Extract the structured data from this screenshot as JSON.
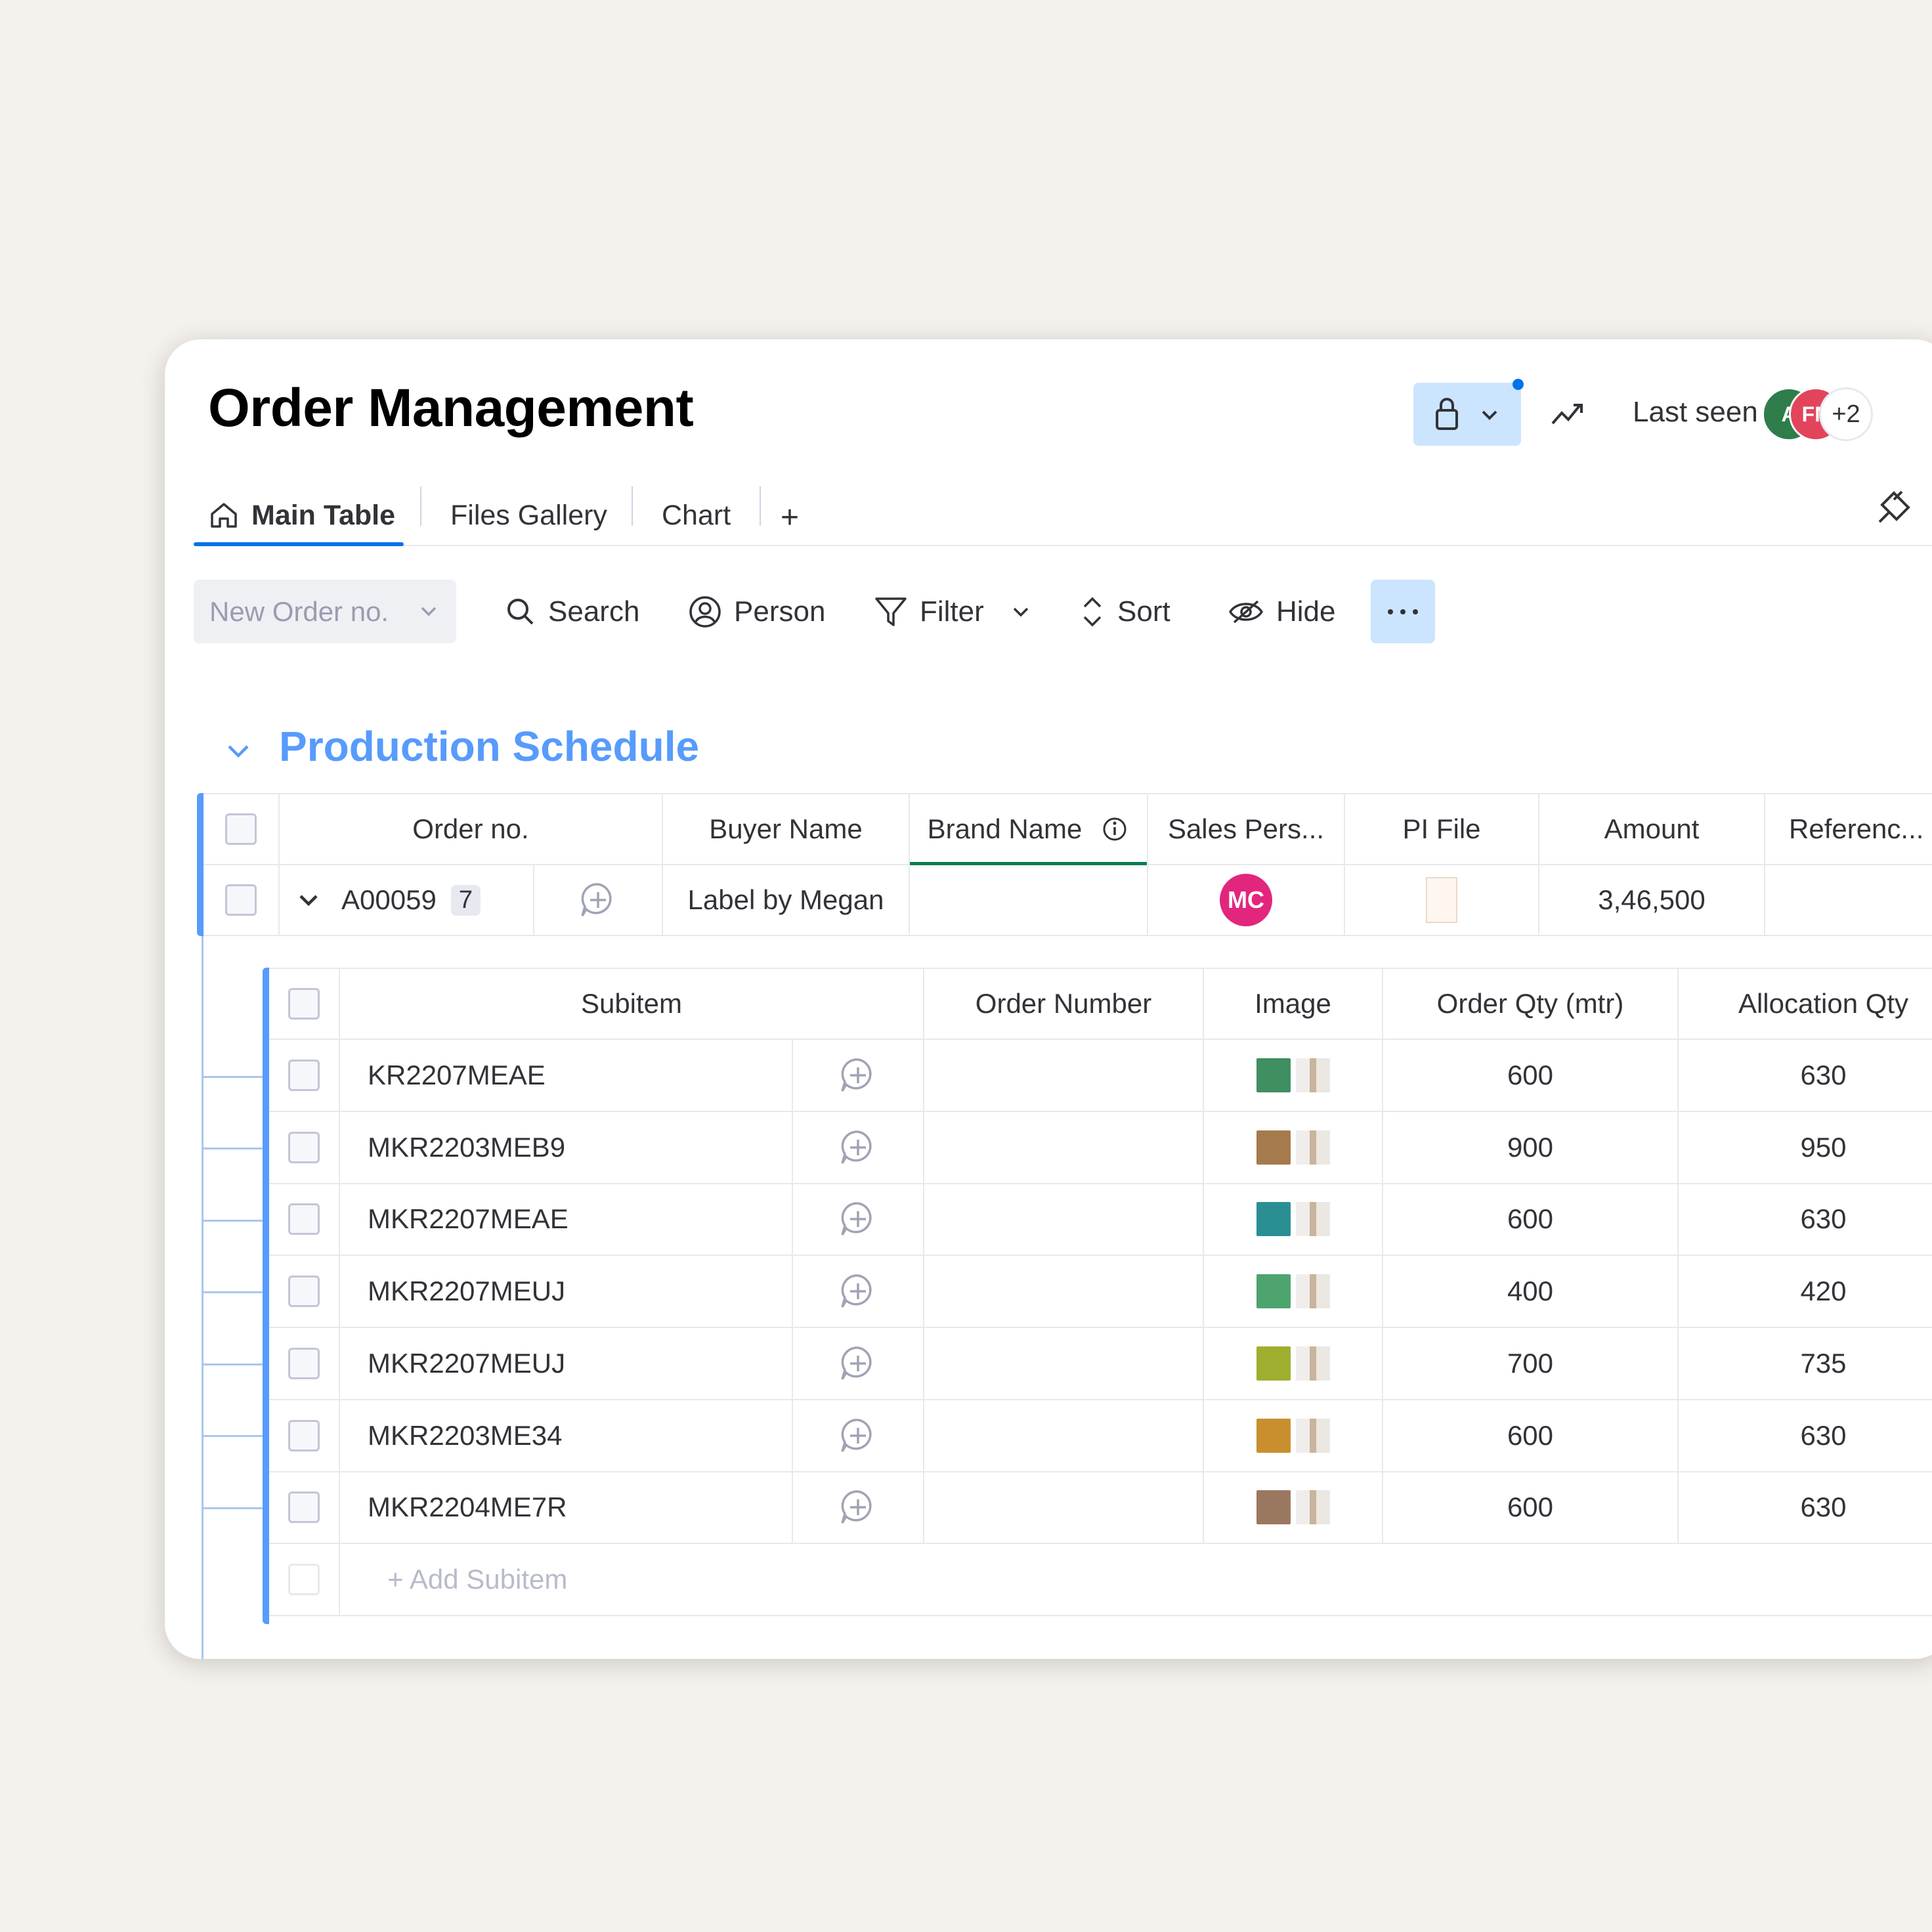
{
  "header": {
    "title": "Order Management",
    "last_seen_label": "Last seen",
    "avatars": [
      {
        "initials": "A",
        "color": "#2e7d4a"
      },
      {
        "initials": "FN",
        "color": "#e2445c"
      },
      {
        "initials": "+2",
        "color": "#ffffff"
      }
    ]
  },
  "tabs": [
    {
      "label": "Main Table",
      "active": true,
      "icon": "home-icon"
    },
    {
      "label": "Files Gallery",
      "active": false
    },
    {
      "label": "Chart",
      "active": false
    },
    {
      "label": "+",
      "active": false
    }
  ],
  "toolbar": {
    "new_item_label": "New Order no.",
    "search_label": "Search",
    "person_label": "Person",
    "filter_label": "Filter",
    "sort_label": "Sort",
    "hide_label": "Hide"
  },
  "group": {
    "title": "Production Schedule",
    "color": "#579bfc",
    "columns": [
      "Order no.",
      "Buyer Name",
      "Brand Name",
      "Sales Pers...",
      "PI File",
      "Amount",
      "Referenc..."
    ],
    "item": {
      "order_no": "A00059",
      "subitem_count": "7",
      "buyer_name": "Label by Megan",
      "brand_name": "",
      "sales_person_initials": "MC",
      "amount": "3,46,500"
    }
  },
  "subtable": {
    "columns": [
      "Subitem",
      "Order Number",
      "Image",
      "Order Qty (mtr)",
      "Allocation Qty"
    ],
    "rows": [
      {
        "name": "KR2207MEAE",
        "order_number": "",
        "order_qty": "600",
        "allocation_qty": "630",
        "swatch": "#3f8f62"
      },
      {
        "name": "MKR2203MEB9",
        "order_number": "",
        "order_qty": "900",
        "allocation_qty": "950",
        "swatch": "#a57a4c"
      },
      {
        "name": "MKR2207MEAE",
        "order_number": "",
        "order_qty": "600",
        "allocation_qty": "630",
        "swatch": "#2a8f93"
      },
      {
        "name": "MKR2207MEUJ",
        "order_number": "",
        "order_qty": "400",
        "allocation_qty": "420",
        "swatch": "#4ea46f"
      },
      {
        "name": "MKR2207MEUJ",
        "order_number": "",
        "order_qty": "700",
        "allocation_qty": "735",
        "swatch": "#9fae2f"
      },
      {
        "name": "MKR2203ME34",
        "order_number": "",
        "order_qty": "600",
        "allocation_qty": "630",
        "swatch": "#c98f2e"
      },
      {
        "name": "MKR2204ME7R",
        "order_number": "",
        "order_qty": "600",
        "allocation_qty": "630",
        "swatch": "#9a7860"
      }
    ],
    "add_label": "+ Add Subitem"
  }
}
